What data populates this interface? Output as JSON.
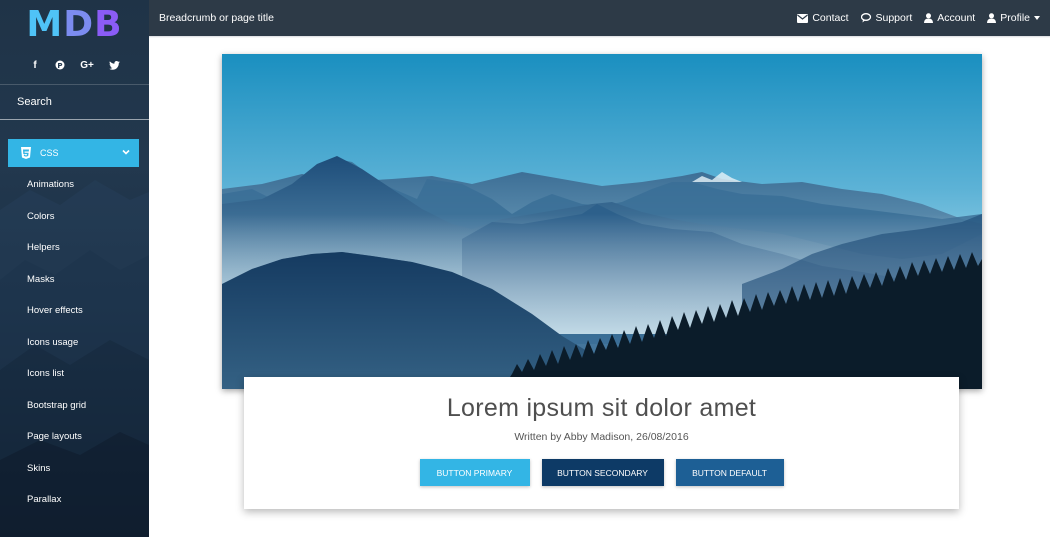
{
  "sidebar": {
    "logo": "MDB",
    "social": [
      {
        "icon": "facebook-icon",
        "glyph": "f"
      },
      {
        "icon": "pinterest-icon",
        "glyph": "P"
      },
      {
        "icon": "google-plus-icon",
        "glyph": "G+"
      },
      {
        "icon": "twitter-icon",
        "glyph": "t"
      }
    ],
    "search_placeholder": "Search",
    "active_section": {
      "label": "CSS",
      "icon": "css3-icon",
      "color": "#33b5e5"
    },
    "items": [
      "Animations",
      "Colors",
      "Helpers",
      "Masks",
      "Hover effects",
      "Icons usage",
      "Icons list",
      "Bootstrap grid",
      "Page layouts",
      "Skins",
      "Parallax"
    ]
  },
  "topbar": {
    "breadcrumb": "Breadcrumb or page title",
    "nav": [
      {
        "label": "Contact",
        "icon": "envelope-icon"
      },
      {
        "label": "Support",
        "icon": "comments-icon"
      },
      {
        "label": "Account",
        "icon": "user-icon"
      },
      {
        "label": "Profile",
        "icon": "user-icon",
        "dropdown": true
      }
    ]
  },
  "card": {
    "title": "Lorem ipsum sit dolor amet",
    "meta": "Written by Abby Madison, 26/08/2016",
    "buttons": {
      "primary": "Button Primary",
      "secondary": "Button Secondary",
      "default": "Button default"
    }
  },
  "colors": {
    "sidebar_bg": "#1f3347",
    "topbar_bg": "#2d3a47",
    "primary": "#33b5e5",
    "secondary": "#0d3a66",
    "default": "#1d5f95"
  }
}
